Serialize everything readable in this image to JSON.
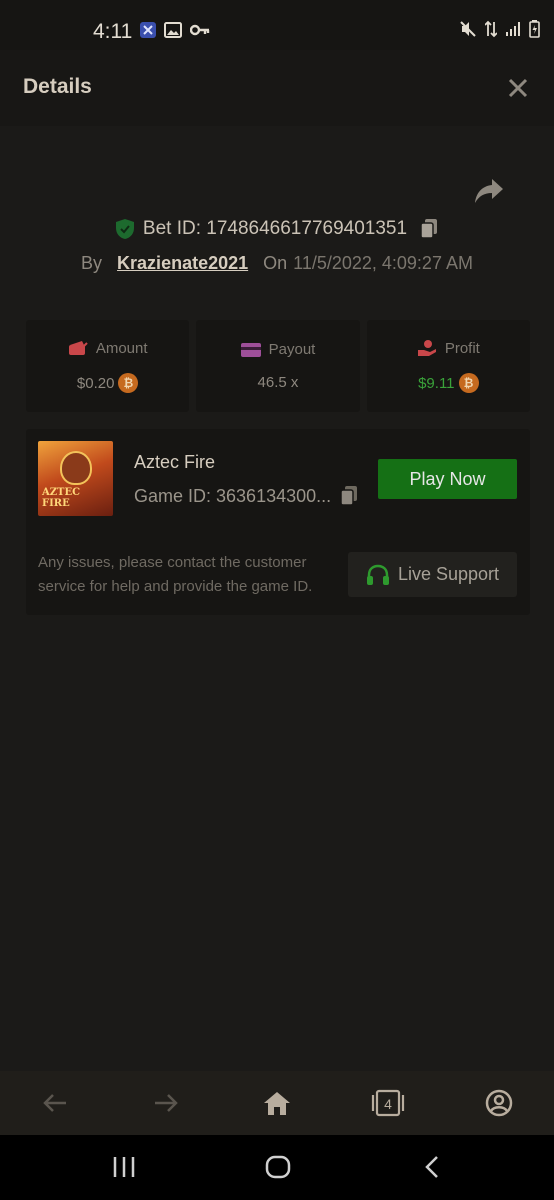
{
  "status_bar": {
    "time": "4:11",
    "left_icons": [
      "x-app-icon",
      "image-icon",
      "key-icon"
    ],
    "right_icons": [
      "mute-icon",
      "data-arrows-icon",
      "signal-icon",
      "battery-icon"
    ]
  },
  "header": {
    "title": "Details",
    "close_icon": "close-icon"
  },
  "bet": {
    "bet_id_label": "Bet ID: 1748646617769401351",
    "by_label": "By",
    "username": "Krazienate2021",
    "on_label": "On",
    "date": "11/5/2022, 4:09:27 AM"
  },
  "stats": {
    "amount": {
      "label": "Amount",
      "value": "$0.20",
      "icon": "wallet-out-icon"
    },
    "payout": {
      "label": "Payout",
      "value": "46.5 x",
      "icon": "card-icon"
    },
    "profit": {
      "label": "Profit",
      "value": "$9.11",
      "icon": "hand-coin-icon"
    }
  },
  "game": {
    "name": "Aztec Fire",
    "game_id": "Game ID: 3636134300...",
    "thumb_text_line1": "AZTEC",
    "thumb_text_line2": "FIRE",
    "play_label": "Play Now",
    "issues_text": "Any issues, please contact the customer service for help and provide the game ID.",
    "support_label": "Live Support"
  },
  "bottom_nav": {
    "tab_count": "4"
  },
  "colors": {
    "background": "#1b1a18",
    "card": "#161513",
    "play_button": "#157015",
    "profit_text": "#3aa23a",
    "coin": "#c66a1f"
  }
}
